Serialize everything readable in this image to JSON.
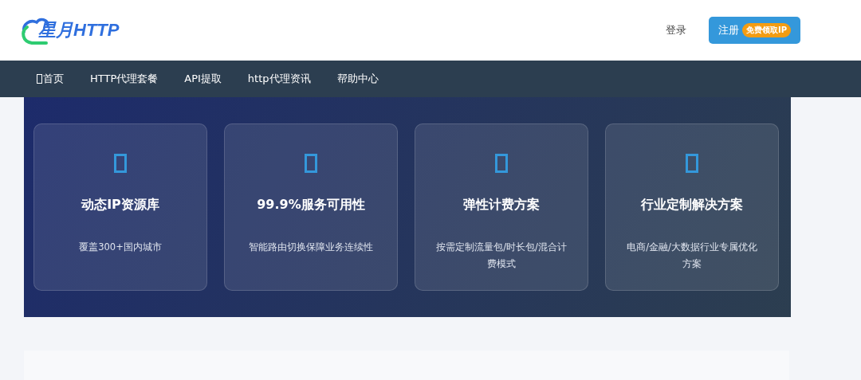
{
  "header": {
    "logo_text": "星月HTTP",
    "login": "登录",
    "register": {
      "label": "注册",
      "badge": "免费领取IP"
    }
  },
  "nav": [
    {
      "label": "首页",
      "icon": true
    },
    {
      "label": "HTTP代理套餐",
      "icon": false
    },
    {
      "label": "API提取",
      "icon": false
    },
    {
      "label": "http代理资讯",
      "icon": false
    },
    {
      "label": "帮助中心",
      "icon": false
    }
  ],
  "features": [
    {
      "title": "动态IP资源库",
      "desc": "覆盖300+国内城市"
    },
    {
      "title": "99.9%服务可用性",
      "desc": "智能路由切换保障业务连续性"
    },
    {
      "title": "弹性计费方案",
      "desc": "按需定制流量包/时长包/混合计费模式"
    },
    {
      "title": "行业定制解决方案",
      "desc": "电商/金融/大数据行业专属优化方案"
    }
  ]
}
